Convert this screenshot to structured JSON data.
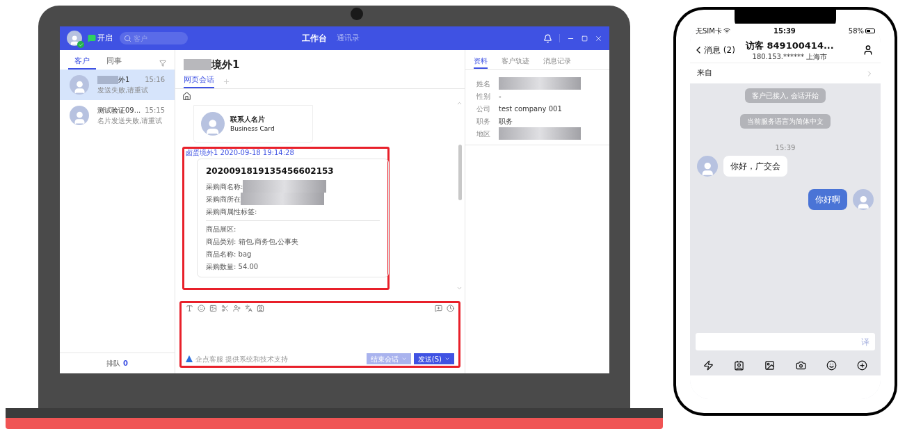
{
  "laptop": {
    "title_bar": {
      "status_label": "开启",
      "search_placeholder": "客户",
      "tabs": [
        {
          "label": "工作台",
          "selected": true
        },
        {
          "label": "通讯录",
          "selected": false
        }
      ]
    },
    "sidebar": {
      "tabs": [
        {
          "label": "客户",
          "selected": true
        },
        {
          "label": "同事",
          "selected": false
        }
      ],
      "contacts": [
        {
          "name": "外1",
          "time": "15:16",
          "preview": "发送失败,请重试",
          "selected": true,
          "redacted": true
        },
        {
          "name": "测试验证09...",
          "time": "15:15",
          "preview": "名片发送失败,请重试",
          "selected": false,
          "redacted": false
        }
      ],
      "queue": {
        "label": "排队",
        "count": "0"
      }
    },
    "conversation": {
      "title": "境外1",
      "tabs": [
        {
          "label": "网页会话",
          "selected": true
        }
      ],
      "business_card": {
        "title": "联系人名片",
        "subtitle": "Business Card"
      },
      "message_meta": "卤蛋境外1 2020-09-18 19:14:28",
      "order": {
        "id": "2020091819135456602153",
        "buyer_fields": [
          {
            "label": "采购商名称:",
            "redacted": true
          },
          {
            "label": "采购商所在",
            "redacted": true
          },
          {
            "label": "采购商属性标签:",
            "redacted": false
          }
        ],
        "product_fields": [
          "商品展区:",
          "商品类别: 箱包,商务包,公事夹",
          "商品名称: bag",
          "采购数量: 54.00"
        ]
      },
      "composer": {
        "footer": "企点客服 提供系统和技术支持",
        "end_button": "结束会话",
        "send_button": "发送(S)"
      }
    },
    "details": {
      "tabs": [
        {
          "label": "资料",
          "selected": true
        },
        {
          "label": "客户轨迹",
          "selected": false
        },
        {
          "label": "消息记录",
          "selected": false
        }
      ],
      "fields": [
        {
          "label": "姓名",
          "kind": "blurred"
        },
        {
          "label": "性别",
          "kind": "text",
          "value": "-"
        },
        {
          "label": "公司",
          "kind": "text",
          "value": "test company 001"
        },
        {
          "label": "职务",
          "kind": "text",
          "value": "职务"
        },
        {
          "label": "地区",
          "kind": "blurred"
        }
      ]
    }
  },
  "phone": {
    "status_bar": {
      "carrier": "无SIM卡",
      "time": "15:39",
      "battery": "58%"
    },
    "nav": {
      "back": "消息 (2)",
      "title": "访客 849100414...",
      "subtitle": "180.153.****** 上海市"
    },
    "source_row": "来自",
    "system_notes": [
      "客户已接入, 会话开始",
      "当前服务语言为简体中文"
    ],
    "time": "15:39",
    "messages": [
      {
        "kind": "incoming",
        "text": "你好，广交会"
      },
      {
        "kind": "outgoing",
        "text": "你好啊"
      }
    ],
    "translate_button": "译"
  }
}
